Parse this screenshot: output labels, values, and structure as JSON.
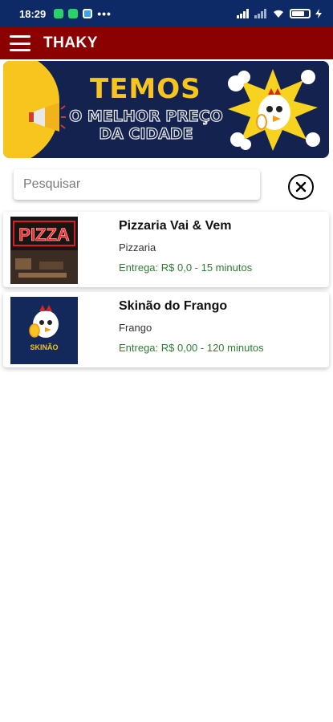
{
  "status_bar": {
    "time": "18:29",
    "overflow_dots": "•••",
    "app_icons": [
      "whatsapp-icon",
      "whatsapp-business-icon",
      "app-icon"
    ],
    "right_icons": [
      "signal-icon",
      "signal-icon-2",
      "wifi-icon",
      "battery-icon"
    ],
    "battery_level": "70%"
  },
  "app_bar": {
    "title": "THAKY",
    "background_color": "#8b0000"
  },
  "banner": {
    "headline": "TEMOS",
    "subline_1": "O MELHOR PREÇO",
    "subline_2": "DA CIDADE",
    "colors": {
      "navy": "#13224e",
      "yellow": "#f7c51e"
    }
  },
  "search": {
    "placeholder": "Pesquisar",
    "value": ""
  },
  "restaurants": [
    {
      "name": "Pizzaria Vai & Vem",
      "category": "Pizzaria",
      "delivery": "Entrega: R$ 0,0 - 15 minutos",
      "thumb_text": "PIZZA"
    },
    {
      "name": "Skinão do Frango",
      "category": "Frango",
      "delivery": "Entrega: R$ 0,00 - 120 minutos",
      "thumb_text": "SKINÃO"
    }
  ]
}
